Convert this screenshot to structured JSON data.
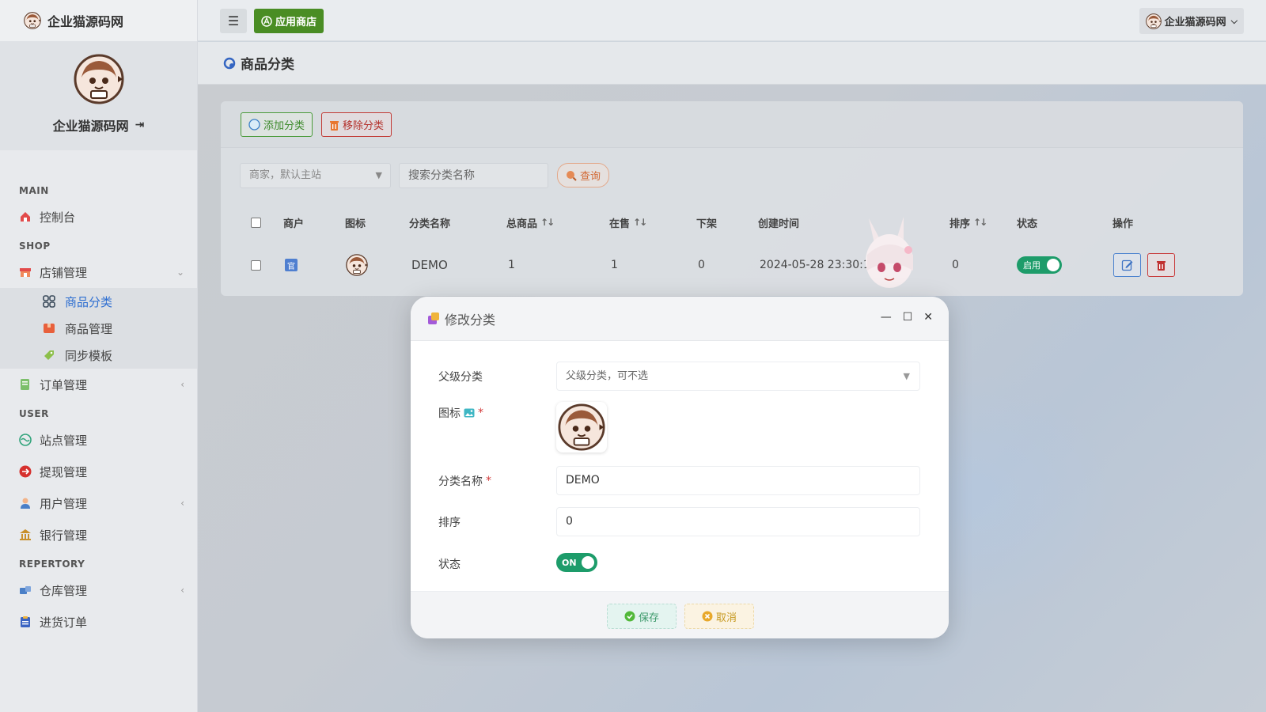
{
  "brand": {
    "name": "企业猫源码网"
  },
  "profile": {
    "name": "企业猫源码网"
  },
  "sidebar": {
    "sections": [
      {
        "title": "MAIN"
      },
      {
        "title": "SHOP"
      },
      {
        "title": "USER"
      },
      {
        "title": "REPERTORY"
      }
    ],
    "items": {
      "dashboard": "控制台",
      "shop_manage": "店铺管理",
      "category": "商品分类",
      "product": "商品管理",
      "sync_template": "同步模板",
      "order": "订单管理",
      "site": "站点管理",
      "withdraw": "提现管理",
      "user": "用户管理",
      "bank": "银行管理",
      "warehouse": "仓库管理",
      "purchase": "进货订单"
    }
  },
  "topbar": {
    "menu_glyph": "☰",
    "store_label": "应用商店",
    "user_label": "企业猫源码网"
  },
  "page": {
    "title": "商品分类"
  },
  "toolbar": {
    "add_label": "添加分类",
    "remove_label": "移除分类"
  },
  "filters": {
    "merchant_placeholder": "商家，默认主站",
    "search_placeholder": "搜索分类名称",
    "query_label": "查询"
  },
  "table": {
    "headers": {
      "merchant": "商户",
      "icon": "图标",
      "name": "分类名称",
      "total": "总商品",
      "on_sale": "在售",
      "off_shelf": "下架",
      "created": "创建时间",
      "sort": "排序",
      "status": "状态",
      "ops": "操作"
    },
    "rows": [
      {
        "merchant_tag": "官",
        "name": "DEMO",
        "total": "1",
        "on_sale": "1",
        "off_shelf": "0",
        "created": "2024-05-28 23:30:1",
        "sort": "0",
        "status": "启用"
      }
    ]
  },
  "modal": {
    "title": "修改分类",
    "fields": {
      "parent_label": "父级分类",
      "parent_placeholder": "父级分类，可不选",
      "icon_label": "图标",
      "name_label": "分类名称",
      "name_value": "DEMO",
      "sort_label": "排序",
      "sort_value": "0",
      "status_label": "状态",
      "status_toggle": "ON"
    },
    "save_label": "保存",
    "cancel_label": "取消"
  },
  "colors": {
    "accent_green": "#1d9c6a",
    "store_green": "#4a8d24",
    "danger": "#c83d3d",
    "link_blue": "#2f6fd1"
  }
}
